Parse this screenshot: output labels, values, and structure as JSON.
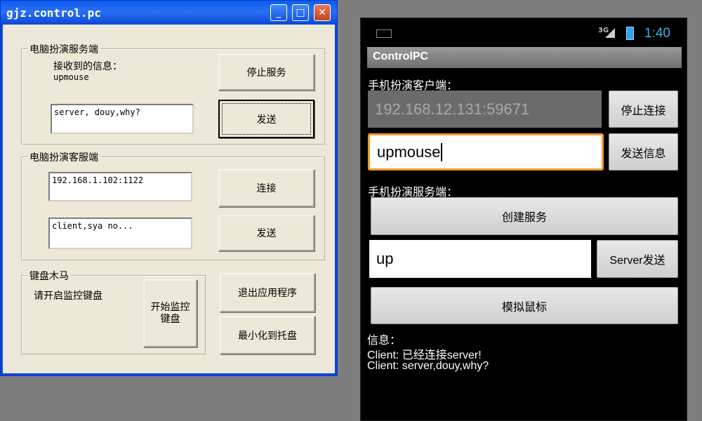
{
  "window": {
    "title": "gjz.control.pc",
    "minimize_glyph": "_",
    "maximize_glyph": "□",
    "close_glyph": "✕"
  },
  "server_group": {
    "legend": "电脑扮演服务端",
    "received_label": "接收到的信息：",
    "received_value": "upmouse",
    "message_input": "server, douy,why?",
    "stop_button": "停止服务",
    "send_button": "发送"
  },
  "client_group": {
    "legend": "电脑扮演客服端",
    "address_input": "192.168.1.102:1122",
    "message_input": "client,sya no...",
    "connect_button": "连接",
    "send_button": "发送"
  },
  "keylogger_group": {
    "legend": "键盘木马",
    "hint": "请开启监控键盘",
    "start_button": "开始监控键盘"
  },
  "actions": {
    "exit_button": "退出应用程序",
    "minimize_tray_button": "最小化到托盘"
  },
  "phone": {
    "status": {
      "network": "3G",
      "time": "1:40"
    },
    "app_title": "ControlPC",
    "client_section_label": "手机扮演客户端：",
    "address_field": "192.168.12.131:59671",
    "stop_connect_button": "停止连接",
    "message_field": "upmouse",
    "send_message_button": "发送信息",
    "server_section_label": "手机扮演服务端：",
    "create_service_button": "创建服务",
    "server_message_field": "up",
    "server_send_button": "Server发送",
    "simulate_mouse_button": "模拟鼠标",
    "info_label": "信息：",
    "info_lines": [
      "Client: 已经连接server!",
      "Client: server,douy,why?"
    ]
  },
  "colors": {
    "xp_titlebar": "#0a5ee8",
    "xp_face": "#ece9d8",
    "android_time": "#33b5e5",
    "focus_border": "#f39a2a"
  }
}
